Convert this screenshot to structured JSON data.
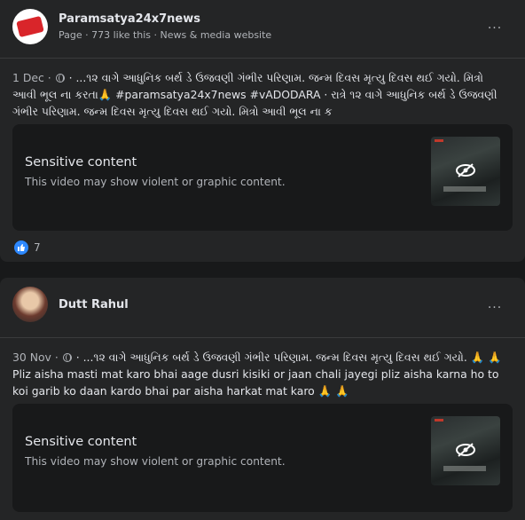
{
  "posts": [
    {
      "author": "Paramsatya24x7news",
      "subtitle": "Page · 773 like this · News & media website",
      "date": "1 Dec",
      "text": "· ...૧૨ વાગે આધુનિક બર્થ ડે ઉજવણી ગંભીર પરિણામ. જન્મ દિવસ મૃત્યુ દિવસ થઈ ગયો. મિત્રો આવી ભૂલ ના કરતા🙏 #paramsatya24x7news #vADODARA · રાત્રે ૧૨ વાગે આધુનિક બર્થ ડે ઉજવણી ગંભીર પરિણામ. જન્મ દિવસ મૃત્યુ દિવસ થઈ ગયો. મિત્રો આવી ભૂલ ના ક",
      "sensitive_title": "Sensitive content",
      "sensitive_desc": "This video may show violent or graphic content.",
      "reaction_count": "7"
    },
    {
      "author": "Dutt Rahul",
      "date": "30 Nov",
      "text": "· ...૧૨ વાગે આધુનિક બર્થ ડે ઉજવણી ગંભીર પરિણામ. જન્મ દિવસ મૃત્યુ દિવસ થઈ ગયો. 🙏 🙏 Pliz aisha masti mat karo bhai aage dusri kisiki or jaan chali jayegi pliz aisha karna ho to koi garib ko daan kardo bhai par aisha harkat mat karo 🙏 🙏",
      "sensitive_title": "Sensitive content",
      "sensitive_desc": "This video may show violent or graphic content."
    }
  ],
  "more_icon": "···",
  "colors": {
    "background": "#18191a",
    "card": "#242526",
    "like": "#2d88ff"
  }
}
